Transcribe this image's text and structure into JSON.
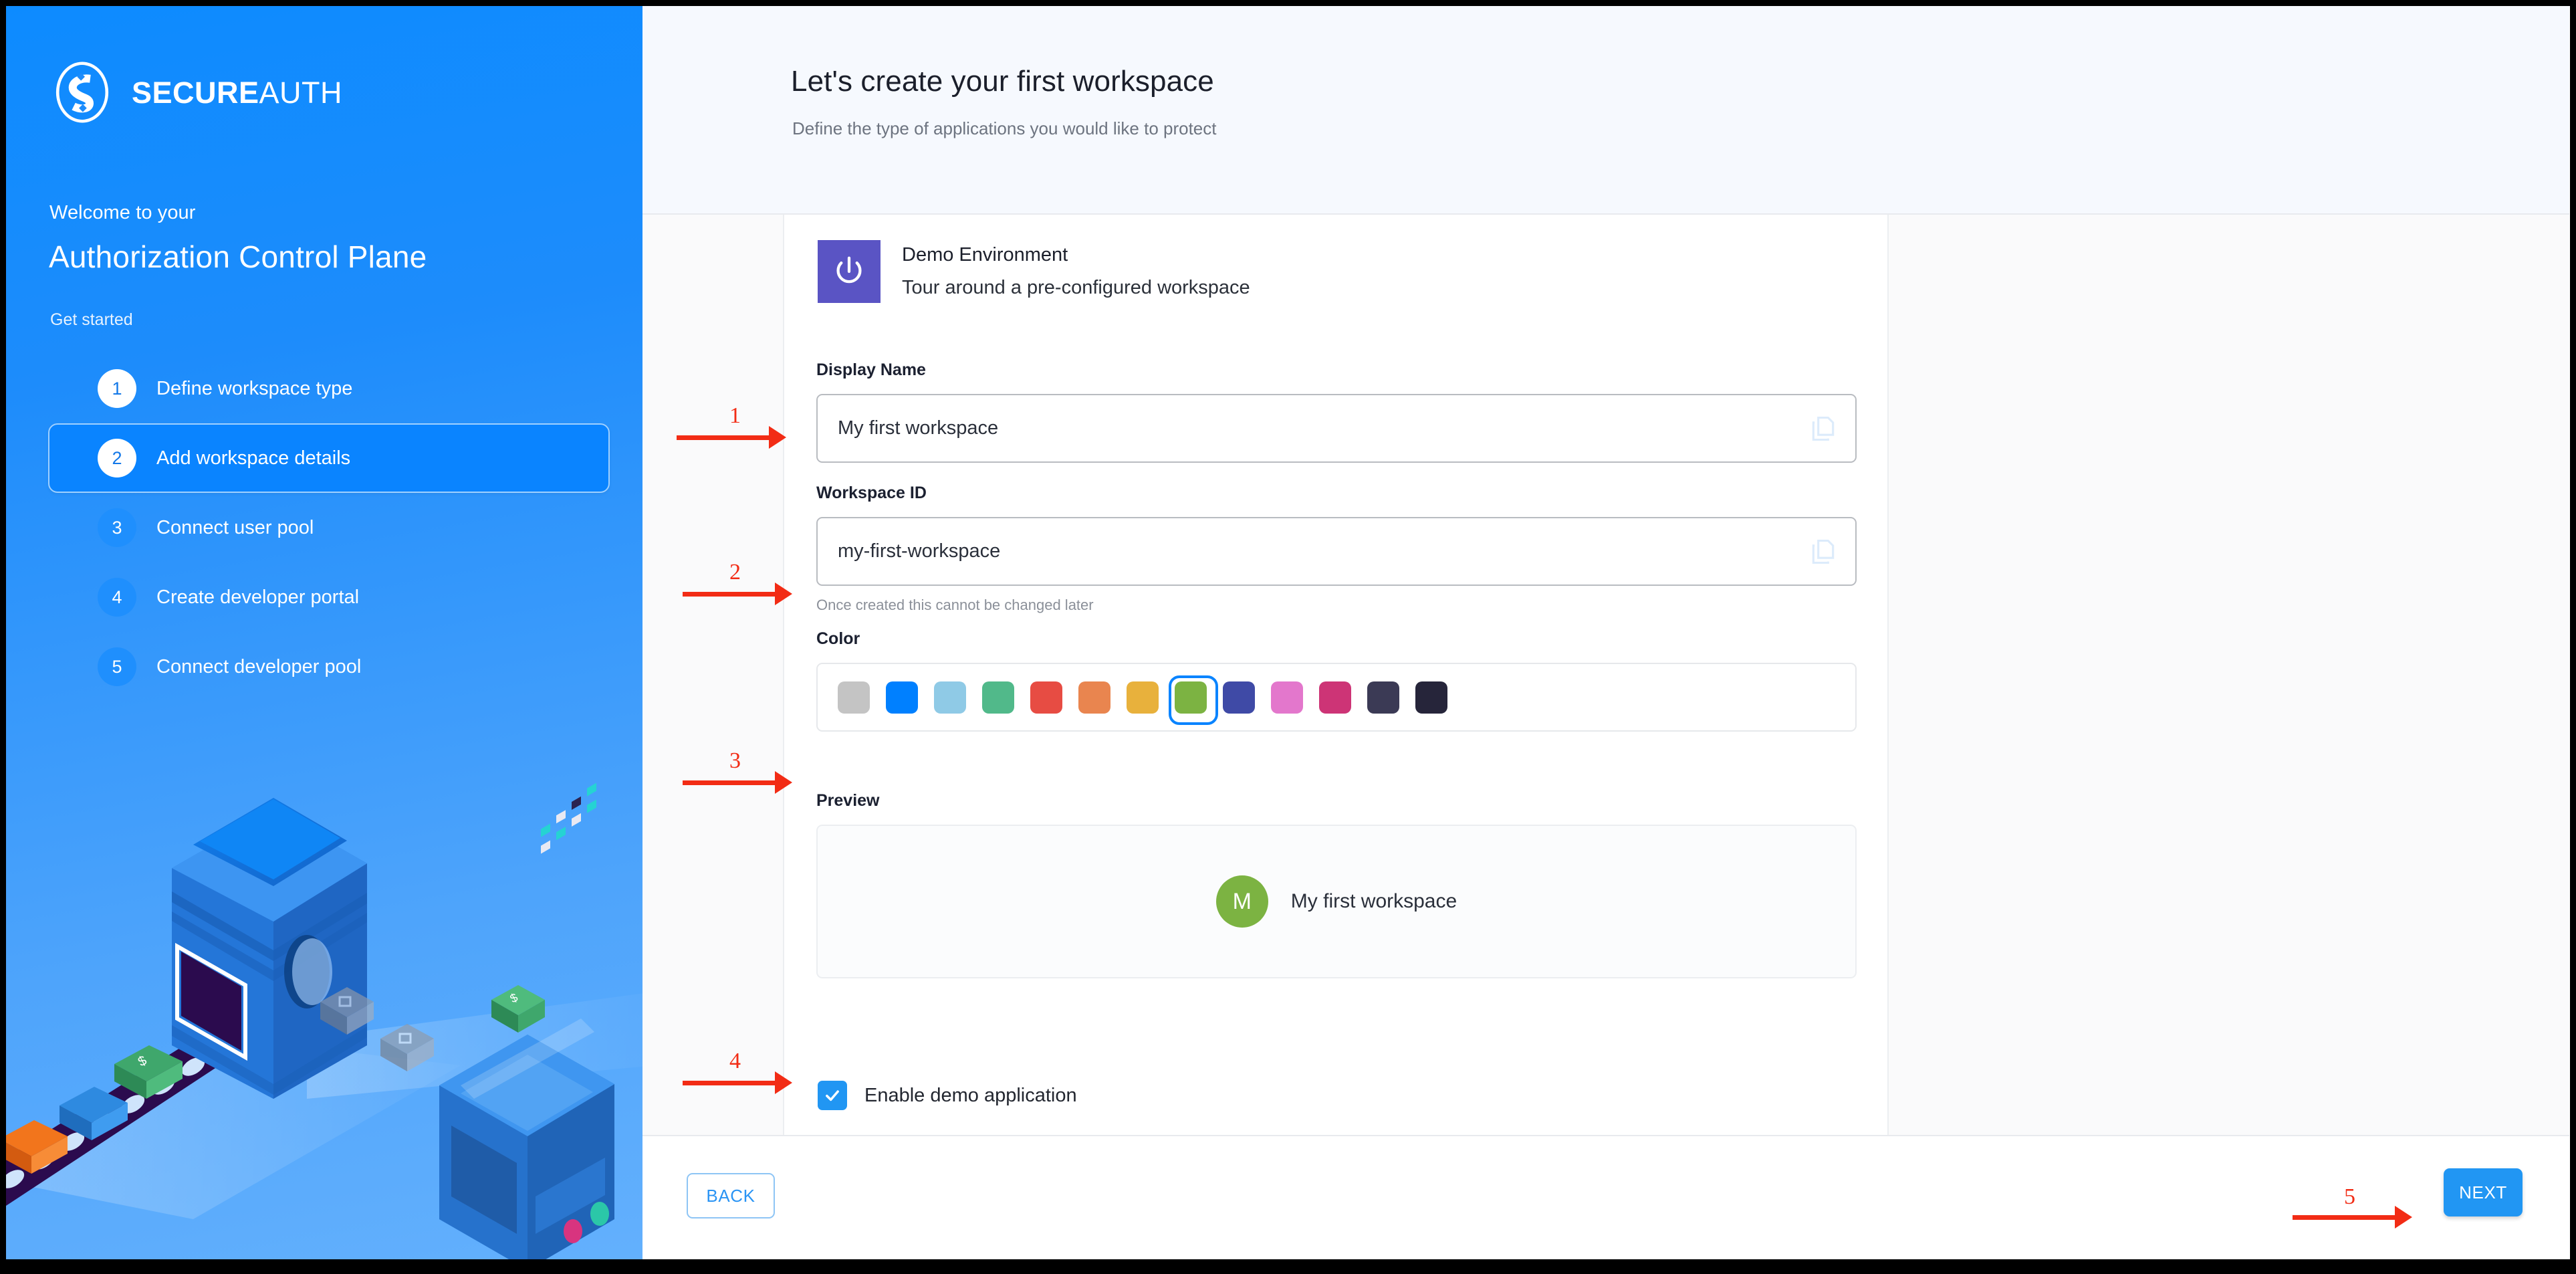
{
  "brand": {
    "logo_text_bold": "SECURE",
    "logo_text_light": "AUTH",
    "logo_icon": "secureauth-s-logo-icon",
    "accent_blue": "#1d8cfb",
    "active_step_blue": "#0a84ff"
  },
  "sidebar": {
    "welcome": "Welcome to your",
    "product": "Authorization Control Plane",
    "section_label": "Get started",
    "steps": [
      {
        "num": "1",
        "label": "Define workspace type",
        "state": "done"
      },
      {
        "num": "2",
        "label": "Add workspace details",
        "state": "active"
      },
      {
        "num": "3",
        "label": "Connect user pool",
        "state": "todo"
      },
      {
        "num": "4",
        "label": "Create developer portal",
        "state": "todo"
      },
      {
        "num": "5",
        "label": "Connect developer pool",
        "state": "todo"
      }
    ],
    "illustration": "isometric-factory-conveyor-illustration"
  },
  "header": {
    "title": "Let's create your first workspace",
    "subtitle": "Define the type of applications you would like to protect"
  },
  "environment": {
    "icon": "power-icon",
    "icon_bg": "#5a54c4",
    "title": "Demo Environment",
    "subtitle": "Tour around a pre-configured workspace"
  },
  "form": {
    "display_name": {
      "label": "Display Name",
      "value": "My first workspace",
      "placeholder": "Display Name",
      "copy_icon": "copy-icon"
    },
    "workspace_id": {
      "label": "Workspace ID",
      "value": "my-first-workspace",
      "placeholder": "Workspace ID",
      "hint": "Once created this cannot be changed later",
      "copy_icon": "copy-icon"
    },
    "color": {
      "label": "Color",
      "selected_index": 7,
      "selected_hex": "#7cb342",
      "swatches": [
        "#c4c4c4",
        "#0080ff",
        "#8fcae6",
        "#51b98a",
        "#e74c43",
        "#e9854f",
        "#e8b13c",
        "#7cb342",
        "#3f4aa6",
        "#e377cc",
        "#cd3476",
        "#3b3a55",
        "#26253a"
      ]
    },
    "preview": {
      "label": "Preview",
      "avatar_initial": "M",
      "avatar_color": "#7cb342",
      "name": "My first workspace"
    },
    "demo_app": {
      "label": "Enable demo application",
      "checked": true,
      "check_icon": "checkmark-icon"
    }
  },
  "footer": {
    "back_label": "BACK",
    "next_label": "NEXT"
  },
  "annotations": {
    "color": "#f22c15",
    "markers": [
      {
        "num": "1",
        "target": "display-name-input"
      },
      {
        "num": "2",
        "target": "workspace-id-input"
      },
      {
        "num": "3",
        "target": "color-palette"
      },
      {
        "num": "4",
        "target": "enable-demo-application-checkbox"
      },
      {
        "num": "5",
        "target": "next-button"
      }
    ]
  }
}
